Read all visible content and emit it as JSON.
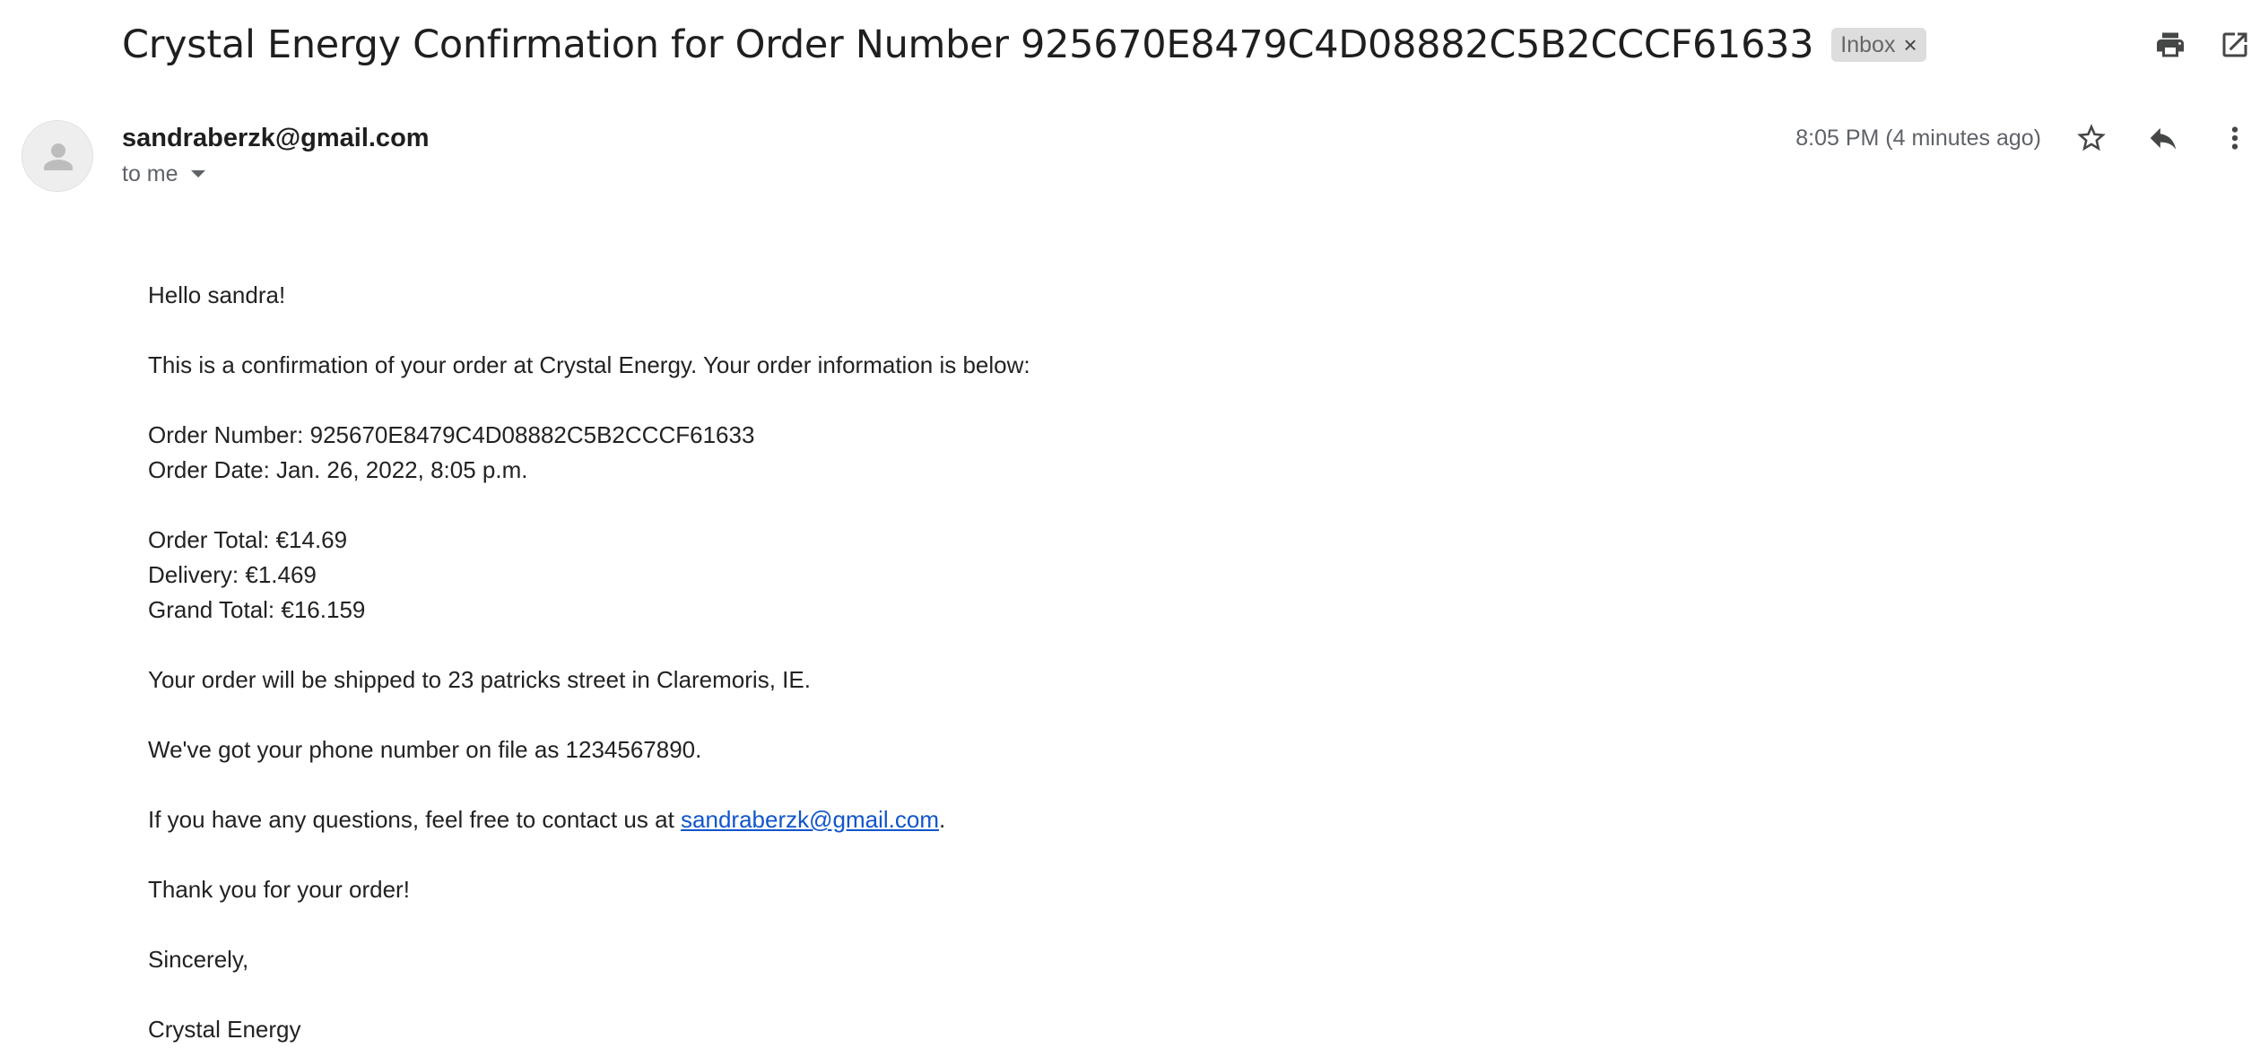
{
  "email": {
    "subject": "Crystal Energy Confirmation for Order Number 925670E8479C4D08882C5B2CCCF61633",
    "label": "Inbox",
    "label_remove": "×",
    "sender": "sandraberzk@gmail.com",
    "recipient_label": "to me",
    "timestamp": "8:05 PM (4 minutes ago)"
  },
  "icons": {
    "print": "print-icon",
    "open_new_window": "open-in-new-window-icon",
    "star": "star-icon",
    "reply": "reply-icon",
    "more": "more-vertical-icon",
    "avatar": "person-avatar-icon",
    "recipient_dropdown": "caret-down-icon"
  },
  "colors": {
    "link": "#1155cc",
    "label_chip_bg": "#dddddd",
    "secondary_text": "#5f6368"
  },
  "body": {
    "greeting": "Hello sandra!",
    "intro": "This is a confirmation of your order at Crystal Energy. Your order information is below:",
    "order_number": "Order Number: 925670E8479C4D08882C5B2CCCF61633",
    "order_date": "Order Date: Jan. 26, 2022, 8:05 p.m.",
    "order_total": "Order Total: €14.69",
    "delivery": "Delivery: €1.469",
    "grand_total": "Grand Total: €16.159",
    "shipping": "Your order will be shipped to 23 patricks street in Claremoris, IE.",
    "phone": "We've got your phone number on file as 1234567890.",
    "contact_prefix": "If you have any questions, feel free to contact us at ",
    "contact_email": "sandraberzk@gmail.com",
    "contact_suffix": ".",
    "thanks": "Thank you for your order!",
    "closing": "Sincerely,",
    "signature": "Crystal Energy"
  }
}
